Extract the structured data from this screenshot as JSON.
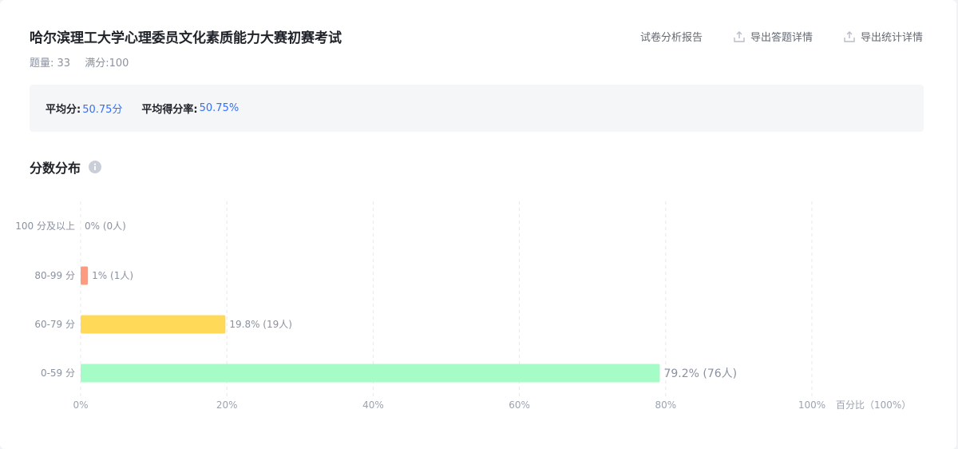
{
  "header": {
    "title": "哈尔滨理工大学心理委员文化素质能力大赛初赛考试",
    "question_count": "题量: 33",
    "full_score": "满分:100"
  },
  "actions": [
    {
      "label": "试卷分析报告",
      "icon": null
    },
    {
      "label": "导出答题详情",
      "icon": "upload-icon"
    },
    {
      "label": "导出统计详情",
      "icon": "upload-icon"
    }
  ],
  "summary": {
    "avg_label": "平均分:",
    "avg_value": "50.75分",
    "rate_label": "平均得分率:",
    "rate_value": "50.75%"
  },
  "section": {
    "title": "分数分布",
    "icon": "info-icon"
  },
  "chart_data": {
    "type": "bar",
    "orientation": "horizontal",
    "categories": [
      "100 分及以上",
      "80-99 分",
      "60-79 分",
      "0-59 分"
    ],
    "values": [
      0,
      1,
      19.8,
      79.2
    ],
    "counts": [
      0,
      1,
      19,
      76
    ],
    "bar_labels": [
      "0% (0人)",
      "1% (1人)",
      "19.8% (19人)",
      "79.2% (76人)"
    ],
    "colors": [
      "#a6f5c4",
      "#fc9b7d",
      "#ffd957",
      "#a6fcc6"
    ],
    "xlim": [
      0,
      100
    ],
    "xticks": [
      "0%",
      "20%",
      "40%",
      "60%",
      "80%",
      "100%"
    ],
    "xlabel": "百分比（100%）",
    "grid": true
  }
}
